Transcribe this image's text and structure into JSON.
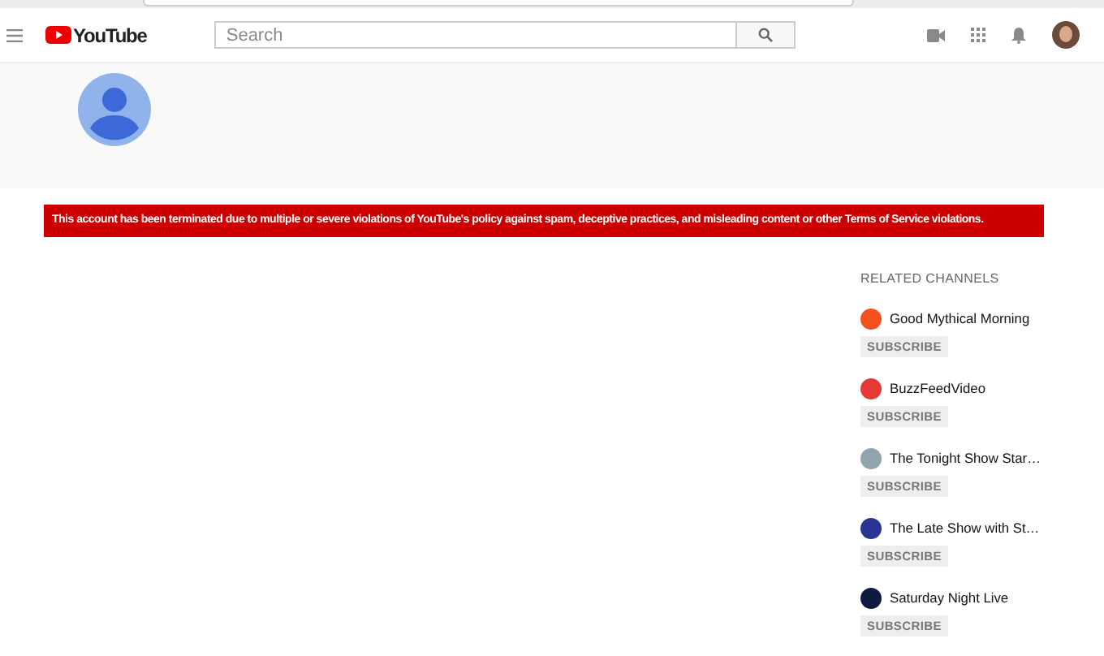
{
  "header": {
    "logo": "YouTube",
    "search": {
      "placeholder": "Search"
    }
  },
  "banner": "This account has been terminated due to multiple or severe violations of YouTube's policy against spam, deceptive practices, and misleading content or other Terms of Service violations.",
  "related_channels": {
    "title": "RELATED CHANNELS",
    "channels": [
      {
        "name": "Good Mythical Morning",
        "color": "#f4511e",
        "button": "SUBSCRIBE"
      },
      {
        "name": "BuzzFeedVideo",
        "color": "#e53935",
        "button": "SUBSCRIBE"
      },
      {
        "name": "The Tonight Show Star…",
        "color": "#90a4ae",
        "button": "SUBSCRIBE"
      },
      {
        "name": "The Late Show with St…",
        "color": "#283593",
        "button": "SUBSCRIBE"
      },
      {
        "name": "Saturday Night Live",
        "color": "#0d1b3e",
        "button": "SUBSCRIBE"
      }
    ]
  }
}
